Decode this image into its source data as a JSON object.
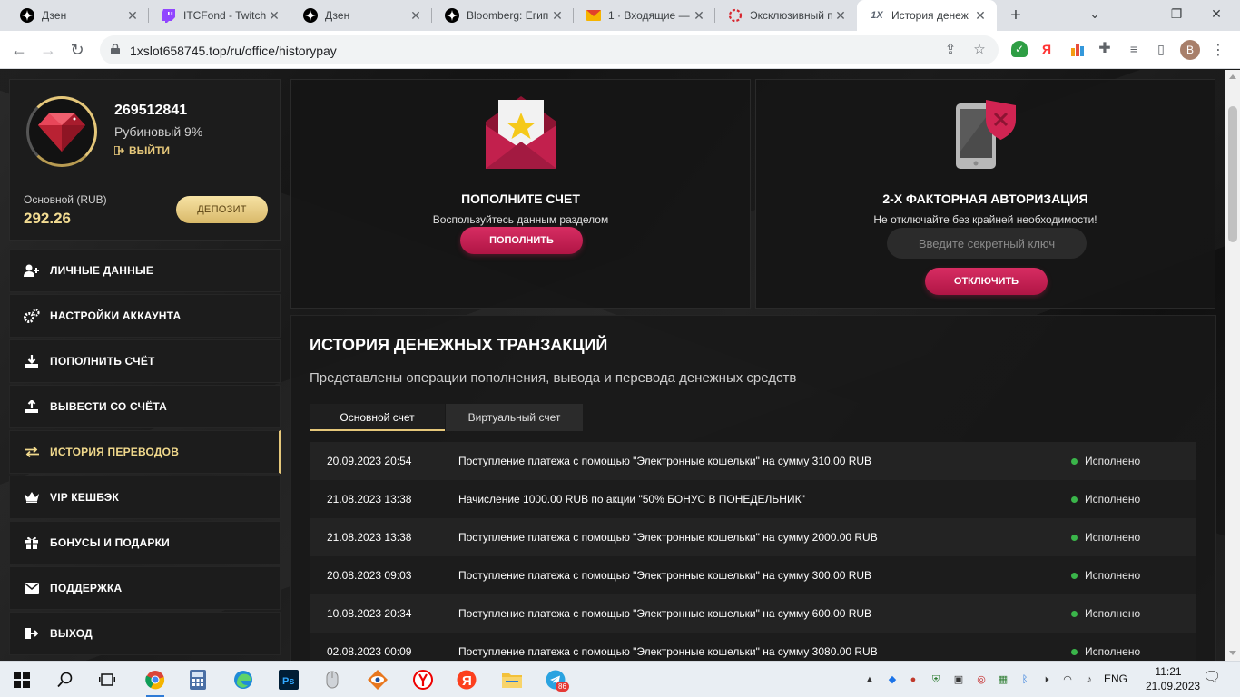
{
  "browser": {
    "tabs": [
      {
        "title": "Дзен",
        "icon": "dzen-icon",
        "active": false
      },
      {
        "title": "ITCFond - Twitch",
        "icon": "twitch-icon",
        "active": false
      },
      {
        "title": "Дзен",
        "icon": "dzen-icon",
        "active": false
      },
      {
        "title": "Bloomberg: Егип",
        "icon": "bloomberg-icon",
        "active": false
      },
      {
        "title": "1 · Входящие — ",
        "icon": "mail-icon",
        "active": false
      },
      {
        "title": "Эксклюзивный п",
        "icon": "loading-icon",
        "active": false
      },
      {
        "title": "История денеж",
        "icon": "1x-icon",
        "active": true
      }
    ],
    "url": "1xslot658745.top/ru/office/historypay",
    "profile_letter": "B"
  },
  "profile": {
    "user_id": "269512841",
    "rank": "Рубиновый 9%",
    "logout_label": "ВЫЙТИ",
    "balance_label": "Основной (RUB)",
    "balance_value": "292.26",
    "deposit_label": "ДЕПОЗИТ"
  },
  "menu": [
    {
      "label": "ЛИЧНЫЕ ДАННЫЕ",
      "icon": "user-add-icon",
      "active": false
    },
    {
      "label": "НАСТРОЙКИ АККАУНТА",
      "icon": "gears-icon",
      "active": false
    },
    {
      "label": "ПОПОЛНИТЬ СЧЁТ",
      "icon": "download-icon",
      "active": false
    },
    {
      "label": "ВЫВЕСТИ СО СЧЁТА",
      "icon": "upload-icon",
      "active": false
    },
    {
      "label": "ИСТОРИЯ ПЕРЕВОДОВ",
      "icon": "transfer-arrows-icon",
      "active": true
    },
    {
      "label": "VIP КЕШБЭК",
      "icon": "crown-icon",
      "active": false
    },
    {
      "label": "БОНУСЫ И ПОДАРКИ",
      "icon": "gift-icon",
      "active": false
    },
    {
      "label": "ПОДДЕРЖКА",
      "icon": "envelope-icon",
      "active": false
    },
    {
      "label": "ВЫХОД",
      "icon": "exit-icon",
      "active": false
    }
  ],
  "topup_card": {
    "title": "ПОПОЛНИТЕ СЧЕТ",
    "subtitle": "Воспользуйтесь данным разделом",
    "button": "ПОПОЛНИТЬ"
  },
  "twofa_card": {
    "title": "2-Х ФАКТОРНАЯ АВТОРИЗАЦИЯ",
    "subtitle": "Не отключайте без крайней необходимости!",
    "input_placeholder": "Введите секретный ключ",
    "button": "ОТКЛЮЧИТЬ"
  },
  "history": {
    "title": "ИСТОРИЯ ДЕНЕЖНЫХ ТРАНЗАКЦИЙ",
    "subtitle": "Представлены операции пополнения, вывода и перевода денежных средств",
    "tabs": [
      "Основной счет",
      "Виртуальный счет"
    ],
    "rows": [
      {
        "date": "20.09.2023 20:54",
        "desc": "Поступление платежа с помощью \"Электронные кошельки\" на сумму 310.00 RUB",
        "status": "Исполнено"
      },
      {
        "date": "21.08.2023 13:38",
        "desc": "Начисление 1000.00 RUB по акции \"50% БОНУС В ПОНЕДЕЛЬНИК\"",
        "status": "Исполнено"
      },
      {
        "date": "21.08.2023 13:38",
        "desc": "Поступление платежа с помощью \"Электронные кошельки\" на сумму 2000.00 RUB",
        "status": "Исполнено"
      },
      {
        "date": "20.08.2023 09:03",
        "desc": "Поступление платежа с помощью \"Электронные кошельки\" на сумму 300.00 RUB",
        "status": "Исполнено"
      },
      {
        "date": "10.08.2023 20:34",
        "desc": "Поступление платежа с помощью \"Электронные кошельки\" на сумму 600.00 RUB",
        "status": "Исполнено"
      },
      {
        "date": "02.08.2023 00:09",
        "desc": "Поступление платежа с помощью \"Электронные кошельки\" на сумму 3080.00 RUB",
        "status": "Исполнено"
      }
    ]
  },
  "taskbar": {
    "language": "ENG",
    "time": "11:21",
    "date": "21.09.2023",
    "telegram_badge": "86"
  },
  "colors": {
    "accent_gold": "#e5c77a",
    "accent_pink": "#c81f52",
    "status_green": "#3ab54a"
  }
}
